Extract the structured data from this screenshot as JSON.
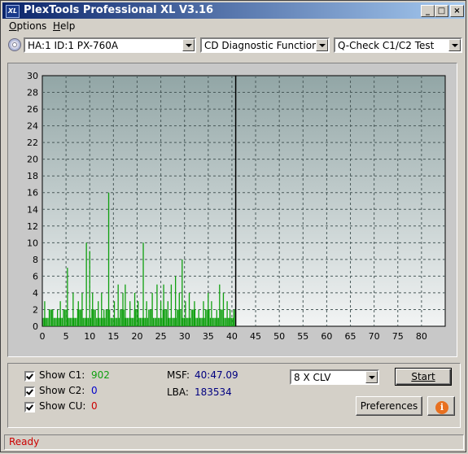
{
  "window": {
    "title": "PlexTools Professional XL V3.16",
    "icon_text": "XL"
  },
  "titlebar_buttons": {
    "minimize": "_",
    "maximize": "□",
    "close": "×"
  },
  "menu": [
    {
      "label": "Options",
      "accel": "O",
      "rest": "ptions"
    },
    {
      "label": "Help",
      "accel": "H",
      "rest": "elp"
    }
  ],
  "toolbar": {
    "drive": "HA:1 ID:1  PX-760A",
    "function": "CD Diagnostic Functions",
    "test": "Q-Check C1/C2 Test"
  },
  "chart_data": {
    "type": "bar",
    "ylim": [
      0,
      30
    ],
    "xlim": [
      0,
      85
    ],
    "yticks": [
      0,
      2,
      4,
      6,
      8,
      10,
      12,
      14,
      16,
      18,
      20,
      22,
      24,
      26,
      28,
      30
    ],
    "xticks": [
      0,
      5,
      10,
      15,
      20,
      25,
      30,
      35,
      40,
      45,
      50,
      55,
      60,
      65,
      70,
      75,
      80
    ],
    "grid": true,
    "series_color": "#10a010",
    "progress_line_x": 40.8,
    "peaks": [
      {
        "x": 0.5,
        "y": 3
      },
      {
        "x": 2.0,
        "y": 2
      },
      {
        "x": 3.2,
        "y": 2
      },
      {
        "x": 3.8,
        "y": 3
      },
      {
        "x": 5.3,
        "y": 7
      },
      {
        "x": 6.5,
        "y": 4
      },
      {
        "x": 7.6,
        "y": 3
      },
      {
        "x": 8.4,
        "y": 4
      },
      {
        "x": 9.3,
        "y": 10
      },
      {
        "x": 10.0,
        "y": 9
      },
      {
        "x": 10.6,
        "y": 4
      },
      {
        "x": 11.8,
        "y": 3
      },
      {
        "x": 12.5,
        "y": 4
      },
      {
        "x": 13.0,
        "y": 2
      },
      {
        "x": 14.0,
        "y": 16
      },
      {
        "x": 15.2,
        "y": 3
      },
      {
        "x": 16.0,
        "y": 5
      },
      {
        "x": 17.0,
        "y": 4
      },
      {
        "x": 17.5,
        "y": 5
      },
      {
        "x": 18.5,
        "y": 3
      },
      {
        "x": 19.5,
        "y": 4
      },
      {
        "x": 20.2,
        "y": 3
      },
      {
        "x": 21.3,
        "y": 10
      },
      {
        "x": 22.0,
        "y": 3
      },
      {
        "x": 23.2,
        "y": 4
      },
      {
        "x": 24.2,
        "y": 5
      },
      {
        "x": 25.0,
        "y": 3
      },
      {
        "x": 25.6,
        "y": 5
      },
      {
        "x": 26.5,
        "y": 3
      },
      {
        "x": 27.2,
        "y": 5
      },
      {
        "x": 28.1,
        "y": 6
      },
      {
        "x": 28.9,
        "y": 4
      },
      {
        "x": 29.5,
        "y": 8
      },
      {
        "x": 30.2,
        "y": 3
      },
      {
        "x": 31.0,
        "y": 4
      },
      {
        "x": 32.1,
        "y": 3
      },
      {
        "x": 33.0,
        "y": 2
      },
      {
        "x": 34.0,
        "y": 3
      },
      {
        "x": 35.0,
        "y": 4
      },
      {
        "x": 35.7,
        "y": 3
      },
      {
        "x": 36.8,
        "y": 2
      },
      {
        "x": 37.4,
        "y": 5
      },
      {
        "x": 38.2,
        "y": 4
      },
      {
        "x": 39.0,
        "y": 3
      },
      {
        "x": 39.6,
        "y": 2
      },
      {
        "x": 40.4,
        "y": 2
      }
    ],
    "baseline": 1
  },
  "counts": {
    "c1_label": "Show C1:",
    "c1_value": "902",
    "c2_label": "Show C2:",
    "c2_value": "0",
    "cu_label": "Show CU:",
    "cu_value": "0"
  },
  "position": {
    "msf_label": "MSF:",
    "msf_value": "40:47.09",
    "lba_label": "LBA:",
    "lba_value": "183534"
  },
  "speed_select": "8 X CLV",
  "buttons": {
    "start": "Start",
    "preferences": "Preferences",
    "info_glyph": "i"
  },
  "status": "Ready",
  "colors": {
    "c1": "#10a010",
    "c2": "#0000cc",
    "cu": "#cc0000",
    "values": "#000080"
  }
}
